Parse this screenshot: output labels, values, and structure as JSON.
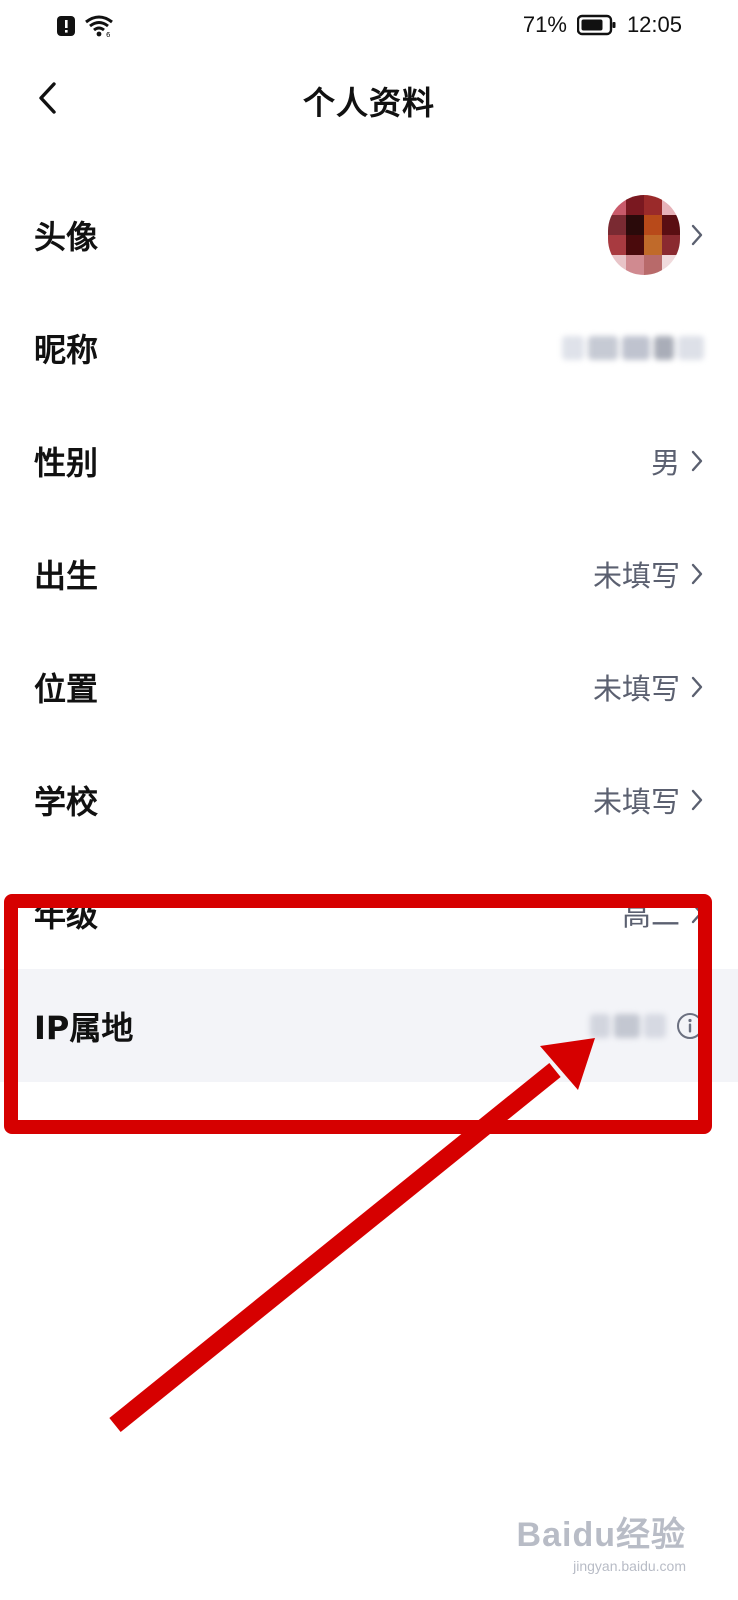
{
  "status_bar": {
    "battery_percent": "71%",
    "time": "12:05",
    "icons": [
      "alert-icon",
      "wifi-icon",
      "battery-icon"
    ]
  },
  "header": {
    "title": "个人资料",
    "back_icon": "chevron-left-icon"
  },
  "rows": [
    {
      "label": "头像",
      "value": "",
      "kind": "avatar"
    },
    {
      "label": "昵称",
      "value": "",
      "kind": "blurred"
    },
    {
      "label": "性别",
      "value": "男",
      "kind": "text"
    },
    {
      "label": "出生",
      "value": "未填写",
      "kind": "text"
    },
    {
      "label": "位置",
      "value": "未填写",
      "kind": "text"
    },
    {
      "label": "学校",
      "value": "未填写",
      "kind": "text"
    },
    {
      "label": "年级",
      "value": "高二",
      "kind": "text"
    },
    {
      "label": "IP属地",
      "value": "",
      "kind": "blurred-info"
    }
  ],
  "watermark": {
    "brand": "Baidu经验",
    "url": "jingyan.baidu.com"
  },
  "colors": {
    "annotation": "#d60000",
    "highlight_row": "#f3f4f8",
    "value_text": "#5b6070"
  }
}
